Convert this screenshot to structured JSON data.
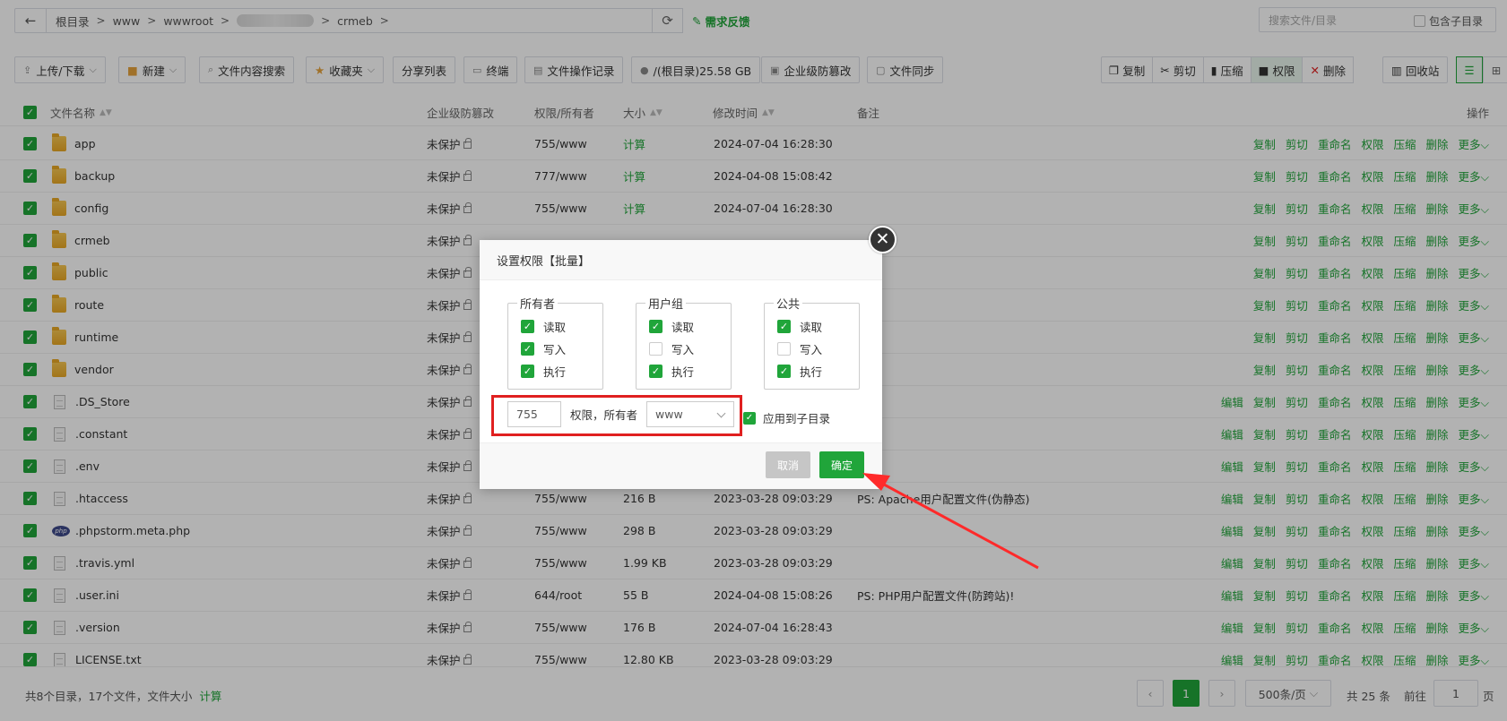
{
  "address": {
    "crumbs": [
      "根目录",
      "www",
      "wwwroot",
      "crmeb"
    ],
    "feedback": "需求反馈"
  },
  "search": {
    "placeholder": "搜索文件/目录",
    "include_sub": "包含子目录"
  },
  "toolbar": {
    "upload": "上传/下载",
    "new": "新建",
    "content_search": "文件内容搜索",
    "favorites": "收藏夹",
    "share": "分享列表",
    "terminal": "终端",
    "ops_log": "文件操作记录",
    "disk": "/(根目录)25.58 GB",
    "tamper": "企业级防篡改",
    "sync": "文件同步",
    "copy": "复制",
    "cut": "剪切",
    "compress": "压缩",
    "perm": "权限",
    "delete": "删除",
    "recycle": "回收站"
  },
  "table": {
    "headers": {
      "name": "文件名称",
      "tamper": "企业级防篡改",
      "perm": "权限/所有者",
      "size": "大小",
      "mtime": "修改时间",
      "note": "备注",
      "ops": "操作"
    },
    "op_edit": "编辑",
    "op_copy": "复制",
    "op_cut": "剪切",
    "op_rename": "重命名",
    "op_perm": "权限",
    "op_compress": "压缩",
    "op_delete": "删除",
    "op_more": "更多",
    "rows": [
      {
        "name": "app",
        "type": "folder",
        "tamper": "未保护",
        "perm": "755/www",
        "size": "计算",
        "mtime": "2024-07-04 16:28:30",
        "note": ""
      },
      {
        "name": "backup",
        "type": "folder",
        "tamper": "未保护",
        "perm": "777/www",
        "size": "计算",
        "mtime": "2024-04-08 15:08:42",
        "note": ""
      },
      {
        "name": "config",
        "type": "folder",
        "tamper": "未保护",
        "perm": "755/www",
        "size": "计算",
        "mtime": "2024-07-04 16:28:30",
        "note": ""
      },
      {
        "name": "crmeb",
        "type": "folder",
        "tamper": "未保护",
        "perm": "",
        "size": "",
        "mtime": "",
        "note": ""
      },
      {
        "name": "public",
        "type": "folder",
        "tamper": "未保护",
        "perm": "",
        "size": "",
        "mtime": "",
        "note": ""
      },
      {
        "name": "route",
        "type": "folder",
        "tamper": "未保护",
        "perm": "",
        "size": "",
        "mtime": "",
        "note": ""
      },
      {
        "name": "runtime",
        "type": "folder",
        "tamper": "未保护",
        "perm": "",
        "size": "",
        "mtime": "",
        "note": ""
      },
      {
        "name": "vendor",
        "type": "folder",
        "tamper": "未保护",
        "perm": "",
        "size": "",
        "mtime": "",
        "note": ""
      },
      {
        "name": ".DS_Store",
        "type": "file",
        "tamper": "未保护",
        "perm": "",
        "size": "",
        "mtime": "",
        "note": ""
      },
      {
        "name": ".constant",
        "type": "file",
        "tamper": "未保护",
        "perm": "",
        "size": "",
        "mtime": "",
        "note": ""
      },
      {
        "name": ".env",
        "type": "file",
        "tamper": "未保护",
        "perm": "",
        "size": "",
        "mtime": "",
        "note": ""
      },
      {
        "name": ".htaccess",
        "type": "file",
        "tamper": "未保护",
        "perm": "755/www",
        "size": "216 B",
        "mtime": "2023-03-28 09:03:29",
        "note": "PS: Apache用户配置文件(伪静态)"
      },
      {
        "name": ".phpstorm.meta.php",
        "type": "php",
        "tamper": "未保护",
        "perm": "755/www",
        "size": "298 B",
        "mtime": "2023-03-28 09:03:29",
        "note": ""
      },
      {
        "name": ".travis.yml",
        "type": "file",
        "tamper": "未保护",
        "perm": "755/www",
        "size": "1.99 KB",
        "mtime": "2023-03-28 09:03:29",
        "note": ""
      },
      {
        "name": ".user.ini",
        "type": "file",
        "tamper": "未保护",
        "perm": "644/root",
        "size": "55 B",
        "mtime": "2024-04-08 15:08:26",
        "note": "PS: PHP用户配置文件(防跨站)!"
      },
      {
        "name": ".version",
        "type": "file",
        "tamper": "未保护",
        "perm": "755/www",
        "size": "176 B",
        "mtime": "2024-07-04 16:28:43",
        "note": ""
      },
      {
        "name": "LICENSE.txt",
        "type": "file",
        "tamper": "未保护",
        "perm": "755/www",
        "size": "12.80 KB",
        "mtime": "2023-03-28 09:03:29",
        "note": ""
      }
    ]
  },
  "footer": {
    "info": "共8个目录，17个文件，文件大小",
    "calc": "计算",
    "page": "1",
    "per_page": "500条/页",
    "total": "共 25 条",
    "goto": "前往",
    "goto_page": "1",
    "page_unit": "页"
  },
  "dialog": {
    "title": "设置权限【批量】",
    "owner": "所有者",
    "group": "用户组",
    "public": "公共",
    "read": "读取",
    "write": "写入",
    "exec": "执行",
    "perm_value": "755",
    "perm_label": "权限，所有者",
    "owner_value": "www",
    "apply_sub": "应用到子目录",
    "cancel": "取消",
    "ok": "确定",
    "owner_checks": [
      true,
      true,
      true
    ],
    "group_checks": [
      true,
      false,
      true
    ],
    "public_checks": [
      true,
      false,
      true
    ]
  }
}
